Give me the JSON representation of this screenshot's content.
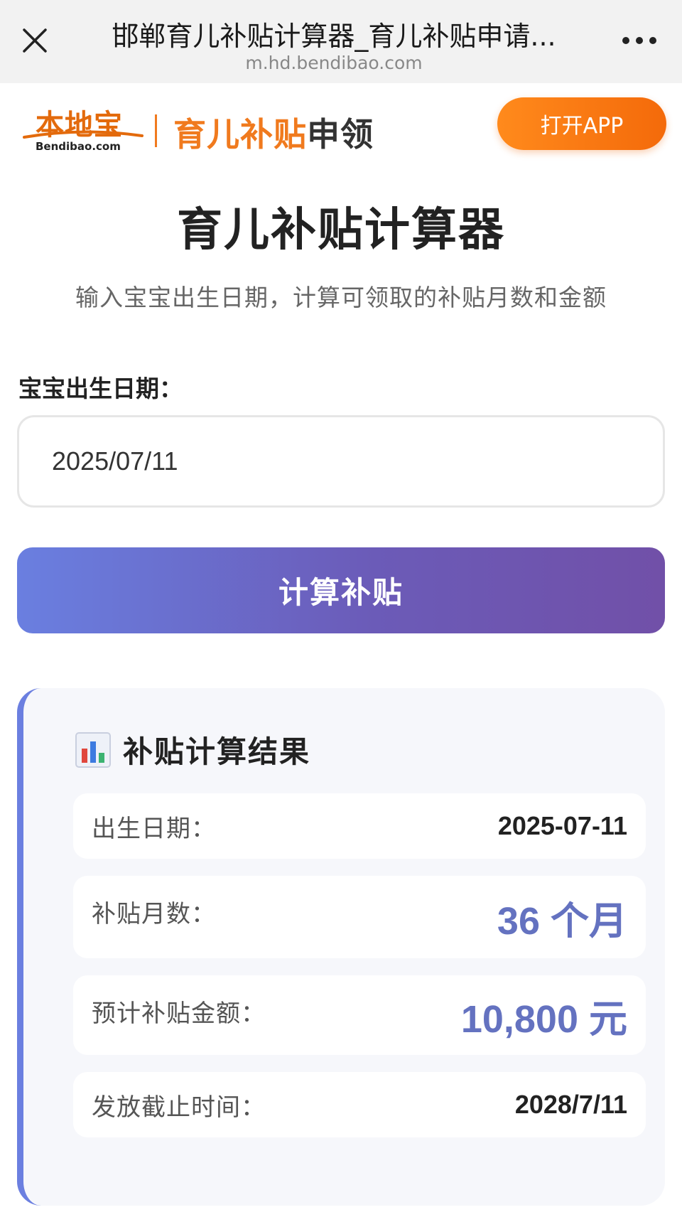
{
  "browser": {
    "title": "邯郸育儿补贴计算器_育儿补贴申请...",
    "domain": "m.hd.bendibao.com"
  },
  "header": {
    "logo_cn": "本地宝",
    "logo_en": "Bendibao.com",
    "slogan_accent": "育儿补贴",
    "slogan_rest": "申领",
    "open_app_label": "打开APP"
  },
  "main": {
    "title": "育儿补贴计算器",
    "subtitle": "输入宝宝出生日期，计算可领取的补贴月数和金额"
  },
  "form": {
    "birth_label": "宝宝出生日期：",
    "birth_value": "2025/07/11",
    "calc_button": "计算补贴"
  },
  "result": {
    "title": "补贴计算结果",
    "rows": [
      {
        "label": "出生日期：",
        "value": "2025-07-11"
      },
      {
        "label": "补贴月数：",
        "value": "36 个月"
      },
      {
        "label": "预计补贴金额：",
        "value": "10,800 元"
      },
      {
        "label": "发放截止时间：",
        "value": "2028/7/11"
      }
    ]
  },
  "colors": {
    "brand_orange": "#f07a1e",
    "button_gradient_start": "#6a7fe0",
    "button_gradient_end": "#7150a8",
    "highlight_value": "#6472c0"
  },
  "icons": [
    "close-icon",
    "more-icon",
    "bar-chart-icon"
  ]
}
